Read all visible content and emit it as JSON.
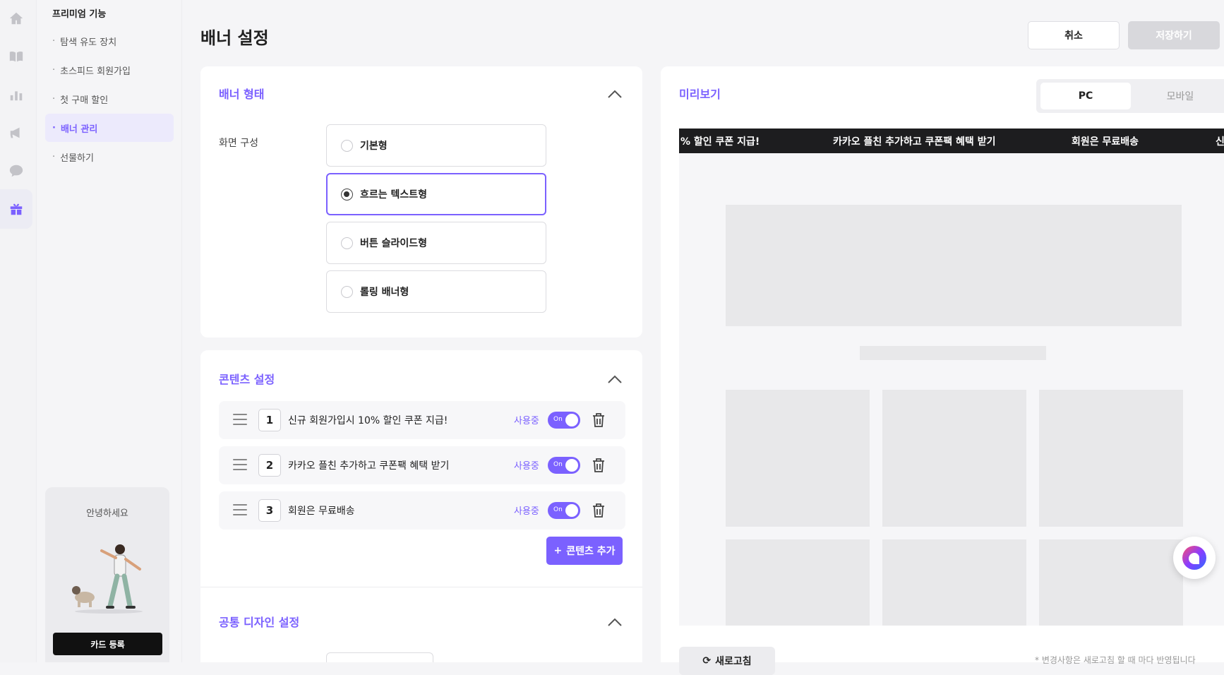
{
  "rail": {
    "icons": [
      "home-icon",
      "book-icon",
      "chart-icon",
      "megaphone-icon",
      "chat-icon",
      "gift-icon"
    ],
    "active": "gift-icon"
  },
  "subnav": {
    "title": "프리미엄 기능",
    "items": [
      {
        "label": "탐색 유도 장치"
      },
      {
        "label": "초스피드 회원가입"
      },
      {
        "label": "첫 구매 할인"
      },
      {
        "label": "배너 관리",
        "active": true
      },
      {
        "label": "선물하기"
      }
    ],
    "greeting": "안녕하세요",
    "card_button": "카드 등록"
  },
  "header": {
    "title": "배너 설정",
    "cancel_label": "취소",
    "save_label": "저장하기"
  },
  "banner_type": {
    "title": "배너 형태",
    "screen_label": "화면 구성",
    "options": [
      {
        "label": "기본형",
        "selected": false
      },
      {
        "label": "흐르는 텍스트형",
        "selected": true
      },
      {
        "label": "버튼 슬라이드형",
        "selected": false
      },
      {
        "label": "롤링 배너형",
        "selected": false
      }
    ]
  },
  "content_settings": {
    "title": "콘텐츠 설정",
    "rows": [
      {
        "index": "1",
        "text": "신규 회원가입시 10% 할인 쿠폰 지급!",
        "status": "사용중",
        "toggle": "On"
      },
      {
        "index": "2",
        "text": "카카오 플친 추가하고 쿠폰팩 혜택 받기",
        "status": "사용중",
        "toggle": "On"
      },
      {
        "index": "3",
        "text": "회원은 무료배송",
        "status": "사용중",
        "toggle": "On"
      }
    ],
    "add_label": "콘텐츠 추가"
  },
  "common_design": {
    "title": "공통 디자인 설정"
  },
  "preview": {
    "title": "미리보기",
    "tab_pc": "PC",
    "tab_mobile": "모바일",
    "ticker": [
      "% 할인 쿠폰 지급!",
      "카카오 플친 추가하고 쿠폰팩 혜택 받기",
      "회원은 무료배송",
      "신"
    ],
    "refresh_label": "새로고침",
    "note": "* 변경사항은 새로고침 할 때 마다 반영됩니다"
  },
  "colors": {
    "accent": "#7b61ff",
    "ticker_bg": "#1d1d1f"
  }
}
